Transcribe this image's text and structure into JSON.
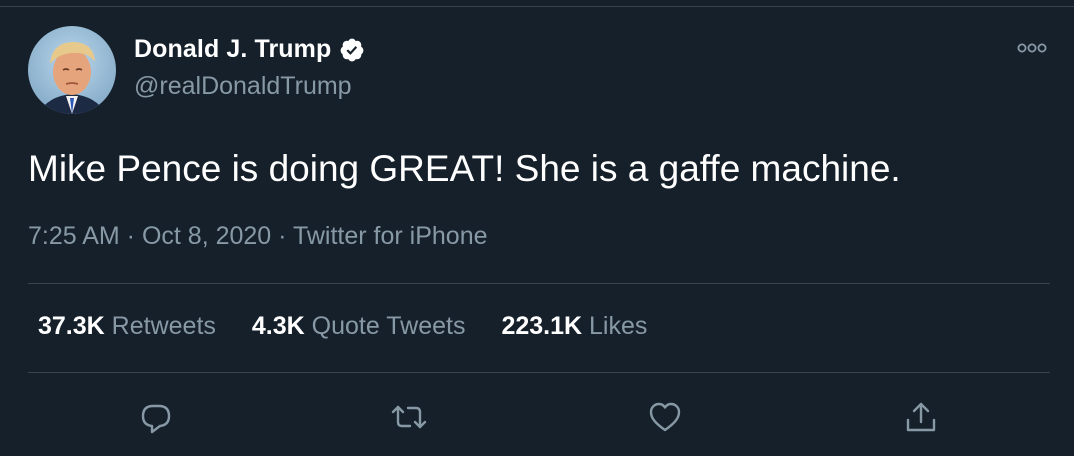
{
  "tweet": {
    "author": {
      "display_name": "Donald J. Trump",
      "handle": "@realDonaldTrump",
      "verified": true
    },
    "text": "Mike Pence is doing GREAT! She is a gaffe machine.",
    "time": "7:25 AM",
    "date": "Oct 8, 2020",
    "source": "Twitter for iPhone",
    "separator": " · ",
    "stats": {
      "retweets_count": "37.3K",
      "retweets_label": "Retweets",
      "quotes_count": "4.3K",
      "quotes_label": "Quote Tweets",
      "likes_count": "223.1K",
      "likes_label": "Likes"
    }
  },
  "icons": {
    "verified": "verified-badge-icon",
    "more": "more-options-icon",
    "reply": "reply-icon",
    "retweet": "retweet-icon",
    "like": "like-icon",
    "share": "share-icon"
  },
  "colors": {
    "background": "#15202b",
    "primary_text": "#ffffff",
    "secondary_text": "#8899a6",
    "divider": "#38444d"
  }
}
